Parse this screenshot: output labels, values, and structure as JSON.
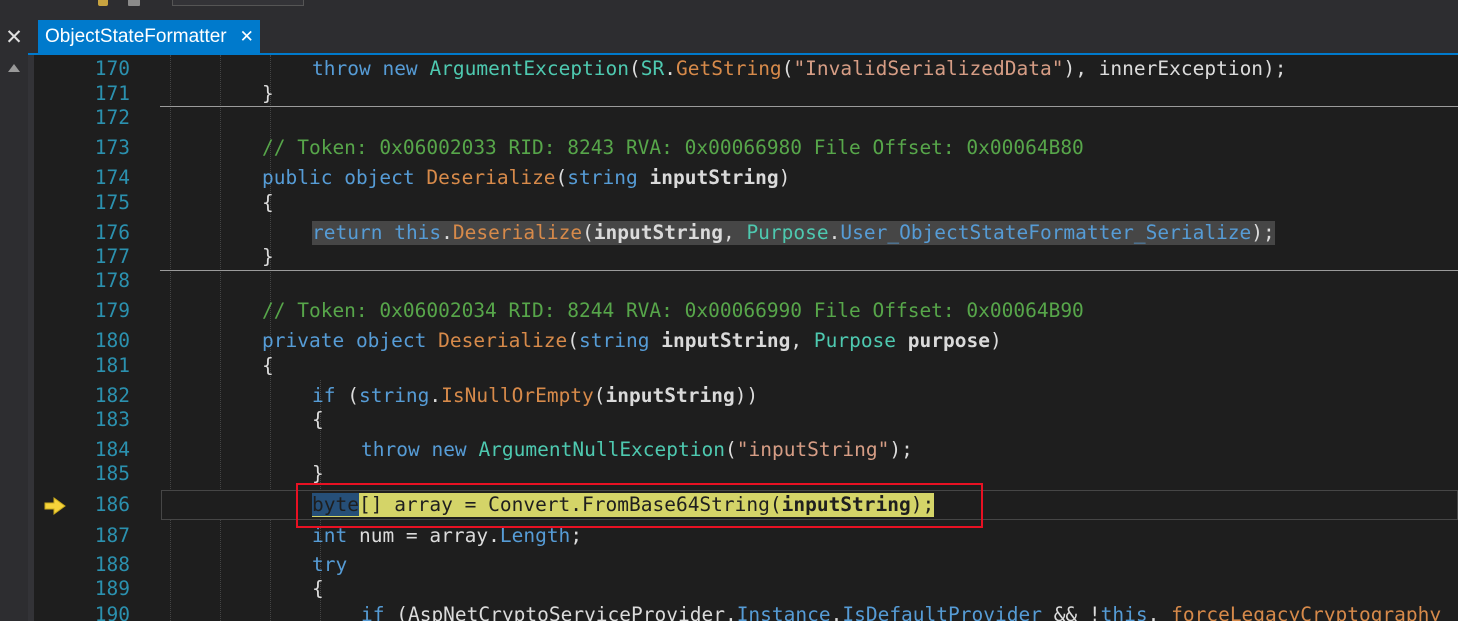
{
  "window": {
    "tab_title": "ObjectStateFormatter",
    "tab_close_glyph": "✕",
    "left_close_glyph": "✕"
  },
  "colors": {
    "accent": "#007acc",
    "keyword": "#569cd6",
    "type": "#4ec9b0",
    "string": "#d69d85",
    "comment": "#57a64a",
    "method": "#d78a4a",
    "line_number": "#2b91af",
    "current_statement_bg": "#d4d468",
    "annotation_box": "#e81123"
  },
  "editor": {
    "current_line": "186",
    "lines": [
      {
        "num": "170",
        "t": [
          [
            "kw",
            "throw"
          ],
          [
            "p",
            " "
          ],
          [
            "kw",
            "new"
          ],
          [
            "p",
            " "
          ],
          [
            "ty",
            "ArgumentException"
          ],
          [
            "p",
            "("
          ],
          [
            "ty",
            "SR"
          ],
          [
            "p",
            "."
          ],
          [
            "mt",
            "GetString"
          ],
          [
            "p",
            "("
          ],
          [
            "st",
            "\"InvalidSerializedData\""
          ],
          [
            "p",
            "), innerException);"
          ]
        ]
      },
      {
        "num": "171",
        "t": [
          [
            "p",
            "}"
          ]
        ]
      },
      {
        "num": "172",
        "t": []
      },
      {
        "num": "173",
        "t": [
          [
            "cm",
            "// Token: 0x06002033 RID: 8243 RVA: 0x00066980 File Offset: 0x00064B80"
          ]
        ]
      },
      {
        "num": "174",
        "t": [
          [
            "kw",
            "public"
          ],
          [
            "p",
            " "
          ],
          [
            "kw",
            "object"
          ],
          [
            "p",
            " "
          ],
          [
            "mt",
            "Deserialize"
          ],
          [
            "p",
            "("
          ],
          [
            "kw",
            "string"
          ],
          [
            "p",
            " "
          ],
          [
            "pa",
            "inputString"
          ],
          [
            "p",
            ")"
          ]
        ]
      },
      {
        "num": "175",
        "t": [
          [
            "p",
            "{"
          ]
        ]
      },
      {
        "num": "176",
        "t": [
          [
            "kw",
            "return"
          ],
          [
            "p",
            " "
          ],
          [
            "kw",
            "this"
          ],
          [
            "p",
            "."
          ],
          [
            "mt",
            "Deserialize"
          ],
          [
            "p",
            "("
          ],
          [
            "pa",
            "inputString"
          ],
          [
            "p",
            ", "
          ],
          [
            "ty",
            "Purpose"
          ],
          [
            "p",
            "."
          ],
          [
            "kw",
            "User_ObjectStateFormatter_Serialize"
          ],
          [
            "p",
            ");"
          ]
        ]
      },
      {
        "num": "177",
        "t": [
          [
            "p",
            "}"
          ]
        ]
      },
      {
        "num": "178",
        "t": []
      },
      {
        "num": "179",
        "t": [
          [
            "cm",
            "// Token: 0x06002034 RID: 8244 RVA: 0x00066990 File Offset: 0x00064B90"
          ]
        ]
      },
      {
        "num": "180",
        "t": [
          [
            "kw",
            "private"
          ],
          [
            "p",
            " "
          ],
          [
            "kw",
            "object"
          ],
          [
            "p",
            " "
          ],
          [
            "mt",
            "Deserialize"
          ],
          [
            "p",
            "("
          ],
          [
            "kw",
            "string"
          ],
          [
            "p",
            " "
          ],
          [
            "pa",
            "inputString"
          ],
          [
            "p",
            ", "
          ],
          [
            "ty",
            "Purpose"
          ],
          [
            "p",
            " "
          ],
          [
            "pa",
            "purpose"
          ],
          [
            "p",
            ")"
          ]
        ]
      },
      {
        "num": "181",
        "t": [
          [
            "p",
            "{"
          ]
        ]
      },
      {
        "num": "182",
        "t": [
          [
            "kw",
            "if"
          ],
          [
            "p",
            " ("
          ],
          [
            "kw",
            "string"
          ],
          [
            "p",
            "."
          ],
          [
            "mt",
            "IsNullOrEmpty"
          ],
          [
            "p",
            "("
          ],
          [
            "pa",
            "inputString"
          ],
          [
            "p",
            "))"
          ]
        ]
      },
      {
        "num": "183",
        "t": [
          [
            "p",
            "{"
          ]
        ]
      },
      {
        "num": "184",
        "t": [
          [
            "kw",
            "throw"
          ],
          [
            "p",
            " "
          ],
          [
            "kw",
            "new"
          ],
          [
            "p",
            " "
          ],
          [
            "ty",
            "ArgumentNullException"
          ],
          [
            "p",
            "("
          ],
          [
            "st",
            "\"inputString\""
          ],
          [
            "p",
            ");"
          ]
        ]
      },
      {
        "num": "185",
        "t": [
          [
            "p",
            "}"
          ]
        ]
      },
      {
        "num": "186",
        "t": [
          [
            "kw",
            "byte"
          ],
          [
            "p",
            "[] array = Convert.FromBase64String("
          ],
          [
            "pa",
            "inputString"
          ],
          [
            "p",
            ");"
          ]
        ]
      },
      {
        "num": "187",
        "t": [
          [
            "kw",
            "int"
          ],
          [
            "p",
            " num = array."
          ],
          [
            "kw",
            "Length"
          ],
          [
            "p",
            ";"
          ]
        ]
      },
      {
        "num": "188",
        "t": [
          [
            "kw",
            "try"
          ]
        ]
      },
      {
        "num": "189",
        "t": [
          [
            "p",
            "{"
          ]
        ]
      },
      {
        "num": "190",
        "t": [
          [
            "kw",
            "if"
          ],
          [
            "p",
            " (AspNetCryptoServiceProvider."
          ],
          [
            "kw",
            "Instance"
          ],
          [
            "p",
            "."
          ],
          [
            "kw",
            "IsDefaultProvider"
          ],
          [
            "p",
            " && !"
          ],
          [
            "kw",
            "this"
          ],
          [
            "p",
            "."
          ],
          [
            "mt",
            "_forceLegacyCryptography"
          ]
        ]
      }
    ]
  }
}
